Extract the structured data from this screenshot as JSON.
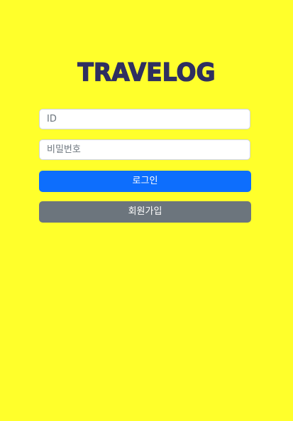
{
  "app": {
    "logo_text": "TRAVELOG"
  },
  "login_form": {
    "id_placeholder": "ID",
    "password_placeholder": "비밀번호",
    "login_label": "로그인",
    "signup_label": "회원가입"
  },
  "colors": {
    "background": "#ffff2b",
    "logo": "#2f2f60",
    "primary": "#0d6efd",
    "secondary": "#6c757d"
  }
}
